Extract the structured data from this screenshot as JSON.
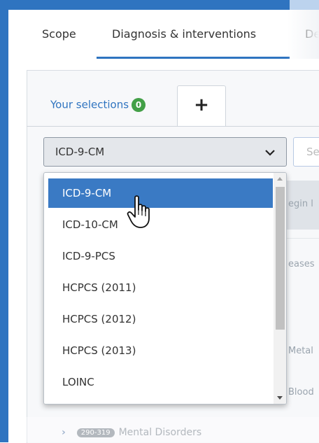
{
  "topnav": {
    "tabs": [
      {
        "label": "Scope"
      },
      {
        "label": "Diagnosis & interventions"
      },
      {
        "label": "De"
      }
    ],
    "active_index": 1
  },
  "subtabs": {
    "selections_label": "Your selections",
    "selections_count": "0",
    "add_label": "+"
  },
  "code_system_select": {
    "value": "ICD-9-CM",
    "icon": "chevron-down-icon"
  },
  "search": {
    "placeholder_partial": "Se"
  },
  "dropdown": {
    "options": [
      "ICD-9-CM",
      "ICD-10-CM",
      "ICD-9-PCS",
      "HCPCS (2011)",
      "HCPCS (2012)",
      "HCPCS (2013)",
      "LOINC"
    ],
    "selected_index": 0
  },
  "background": {
    "header_text": "egin l",
    "rows": [
      "eases",
      "Metal",
      "Blood"
    ],
    "bottom_row": {
      "code": "290-319",
      "label": "Mental Disorders"
    }
  },
  "colors": {
    "accent": "#2f74c0",
    "selected_option": "#3a7ac4",
    "badge": "#43a047"
  }
}
